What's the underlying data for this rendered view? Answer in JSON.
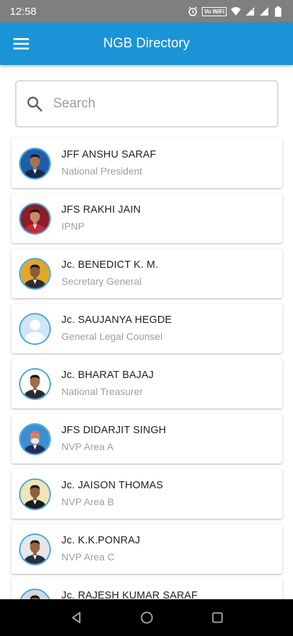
{
  "status_bar": {
    "time": "12:58",
    "icons": [
      "alarm-icon",
      "vowifi-icon",
      "wifi-icon",
      "signal-icon",
      "signal-icon",
      "battery-icon"
    ],
    "vowifi_label": "Vo WiFi"
  },
  "app_bar": {
    "title": "NGB Directory",
    "menu_icon": "hamburger-menu-icon"
  },
  "search": {
    "placeholder": "Search",
    "value": ""
  },
  "members": [
    {
      "name": "JFF ANSHU SARAF",
      "role": "National President",
      "avatar": "photo"
    },
    {
      "name": "JFS RAKHI JAIN",
      "role": "IPNP",
      "avatar": "photo"
    },
    {
      "name": "Jc. BENEDICT K. M.",
      "role": "Secretary General",
      "avatar": "photo"
    },
    {
      "name": "Jc. SAUJANYA HEGDE",
      "role": "General Legal Counsel",
      "avatar": "placeholder"
    },
    {
      "name": "Jc. BHARAT BAJAJ",
      "role": "National Treasurer",
      "avatar": "photo"
    },
    {
      "name": "JFS DIDARJIT SINGH",
      "role": "NVP Area A",
      "avatar": "photo"
    },
    {
      "name": "Jc. JAISON THOMAS",
      "role": "NVP Area B",
      "avatar": "photo"
    },
    {
      "name": "Jc. K.K.PONRAJ",
      "role": "NVP Area C",
      "avatar": "photo"
    },
    {
      "name": "Jc. RAJESH KUMAR SARAF",
      "role": "",
      "avatar": "photo"
    }
  ],
  "nav_bar": {
    "buttons": [
      "back-icon",
      "home-icon",
      "recents-icon"
    ]
  },
  "colors": {
    "app_bar": "#1a94d6",
    "status_bar": "#7f7f7f",
    "avatar_ring": "#4aa6de",
    "name_text": "#212121",
    "role_text": "#9e9e9e"
  }
}
